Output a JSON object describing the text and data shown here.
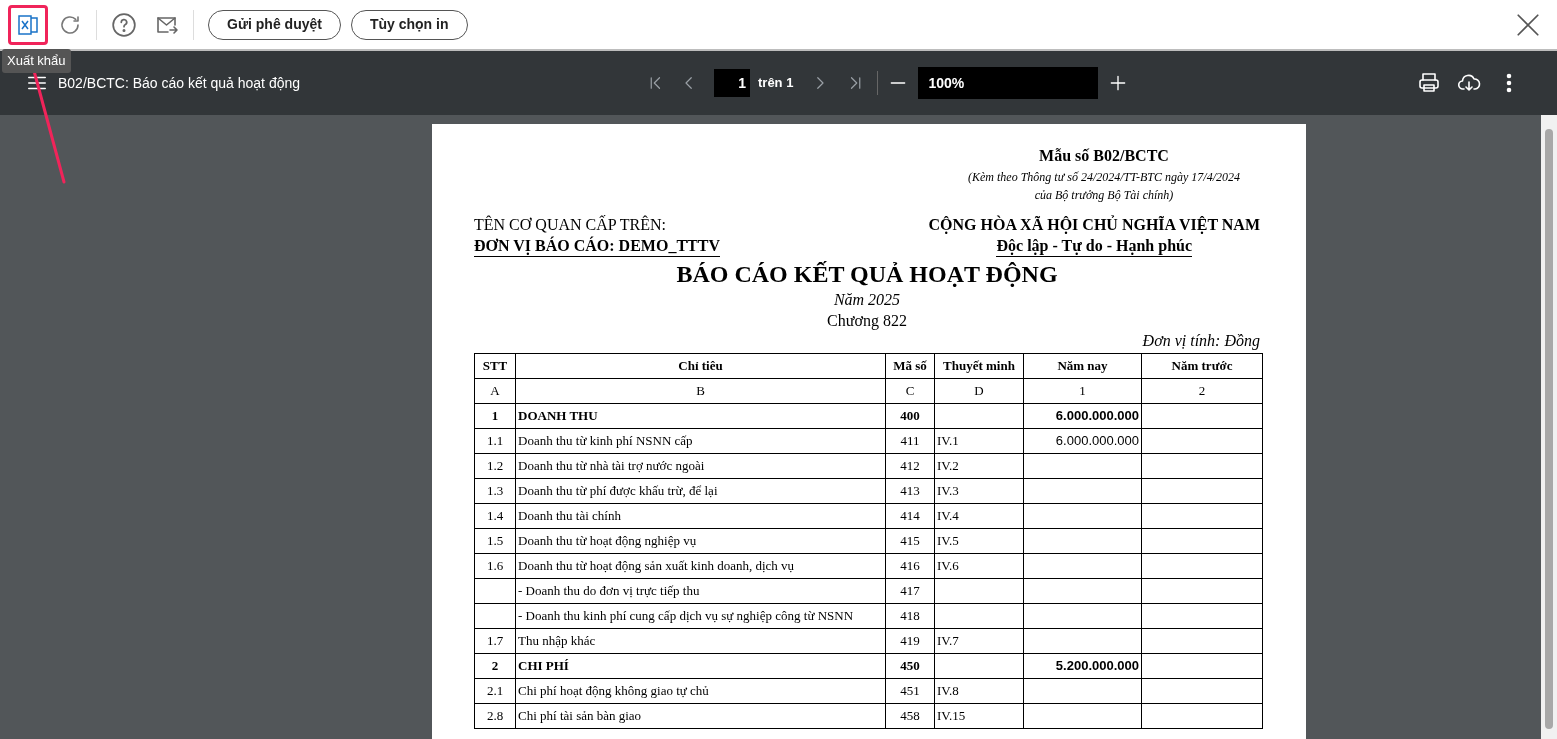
{
  "toolbar": {
    "buttons": [
      "Gửi phê duyệt",
      "Tùy chọn in"
    ],
    "tooltip": "Xuất khẩu"
  },
  "viewer": {
    "title": "B02/BCTC: Báo cáo kết quả hoạt động",
    "page": "1",
    "page_total": "trên 1",
    "zoom": "100%"
  },
  "document": {
    "form_no": "Mẫu số B02/BCTC",
    "form_note_1": "(Kèm theo Thông tư số 24/2024/TT-BTC ngày 17/4/2024",
    "form_note_2": "của Bộ trưởng Bộ Tài chính)",
    "parent_agency": "TÊN CƠ QUAN CẤP TRÊN:",
    "reporting_unit": "ĐƠN VỊ BÁO CÁO: DEMO_TTTV",
    "nation": "CỘNG HÒA XÃ HỘI CHỦ NGHĨA VIỆT NAM",
    "motto": "Độc lập - Tự do - Hạnh phúc",
    "title": "BÁO CÁO KẾT QUẢ HOẠT ĐỘNG",
    "year": "Năm 2025",
    "chapter": "Chương 822",
    "unit": "Đơn vị tính: Đồng",
    "table": {
      "columns": [
        "STT",
        "Chỉ tiêu",
        "Mã số",
        "Thuyết minh",
        "Năm nay",
        "Năm trước"
      ],
      "column_codes": [
        "A",
        "B",
        "C",
        "D",
        "1",
        "2"
      ],
      "rows": [
        {
          "kind": "group",
          "stt": "1",
          "label": "DOANH THU",
          "code": "400",
          "note": "",
          "this_year": "6.000.000.000"
        },
        {
          "kind": "item",
          "stt": "1.1",
          "label": "Doanh thu từ kinh phí NSNN cấp",
          "code": "411",
          "note": "IV.1",
          "this_year": "6.000.000.000"
        },
        {
          "kind": "item",
          "stt": "1.2",
          "label": "Doanh thu từ nhà tài trợ nước ngoài",
          "code": "412",
          "note": "IV.2",
          "this_year": ""
        },
        {
          "kind": "item",
          "stt": "1.3",
          "label": "Doanh thu từ phí được khấu trừ, để lại",
          "code": "413",
          "note": "IV.3",
          "this_year": ""
        },
        {
          "kind": "item",
          "stt": "1.4",
          "label": "Doanh thu tài chính",
          "code": "414",
          "note": "IV.4",
          "this_year": ""
        },
        {
          "kind": "item",
          "stt": "1.5",
          "label": "Doanh thu từ hoạt động nghiệp vụ",
          "code": "415",
          "note": "IV.5",
          "this_year": ""
        },
        {
          "kind": "item",
          "stt": "1.6",
          "label": "Doanh thu từ hoạt động sản xuất kinh doanh, dịch vụ",
          "code": "416",
          "note": "IV.6",
          "this_year": ""
        },
        {
          "kind": "item",
          "stt": "",
          "label": "- Doanh thu do đơn vị trực tiếp thu",
          "code": "417",
          "note": "",
          "this_year": ""
        },
        {
          "kind": "item",
          "stt": "",
          "label": "- Doanh thu kinh phí cung cấp dịch vụ sự nghiệp công từ NSNN",
          "code": "418",
          "note": "",
          "this_year": ""
        },
        {
          "kind": "item",
          "stt": "1.7",
          "label": "Thu nhập khác",
          "code": "419",
          "note": "IV.7",
          "this_year": ""
        },
        {
          "kind": "group",
          "stt": "2",
          "label": "CHI PHÍ",
          "code": "450",
          "note": "",
          "this_year": "5.200.000.000"
        },
        {
          "kind": "item",
          "stt": "2.1",
          "label": "Chi phí hoạt động không giao tự chủ",
          "code": "451",
          "note": "IV.8",
          "this_year": ""
        },
        {
          "kind": "item",
          "stt": "2.8",
          "label": "Chi phí tài sản bàn giao",
          "code": "458",
          "note": "IV.15",
          "this_year": ""
        }
      ]
    }
  }
}
